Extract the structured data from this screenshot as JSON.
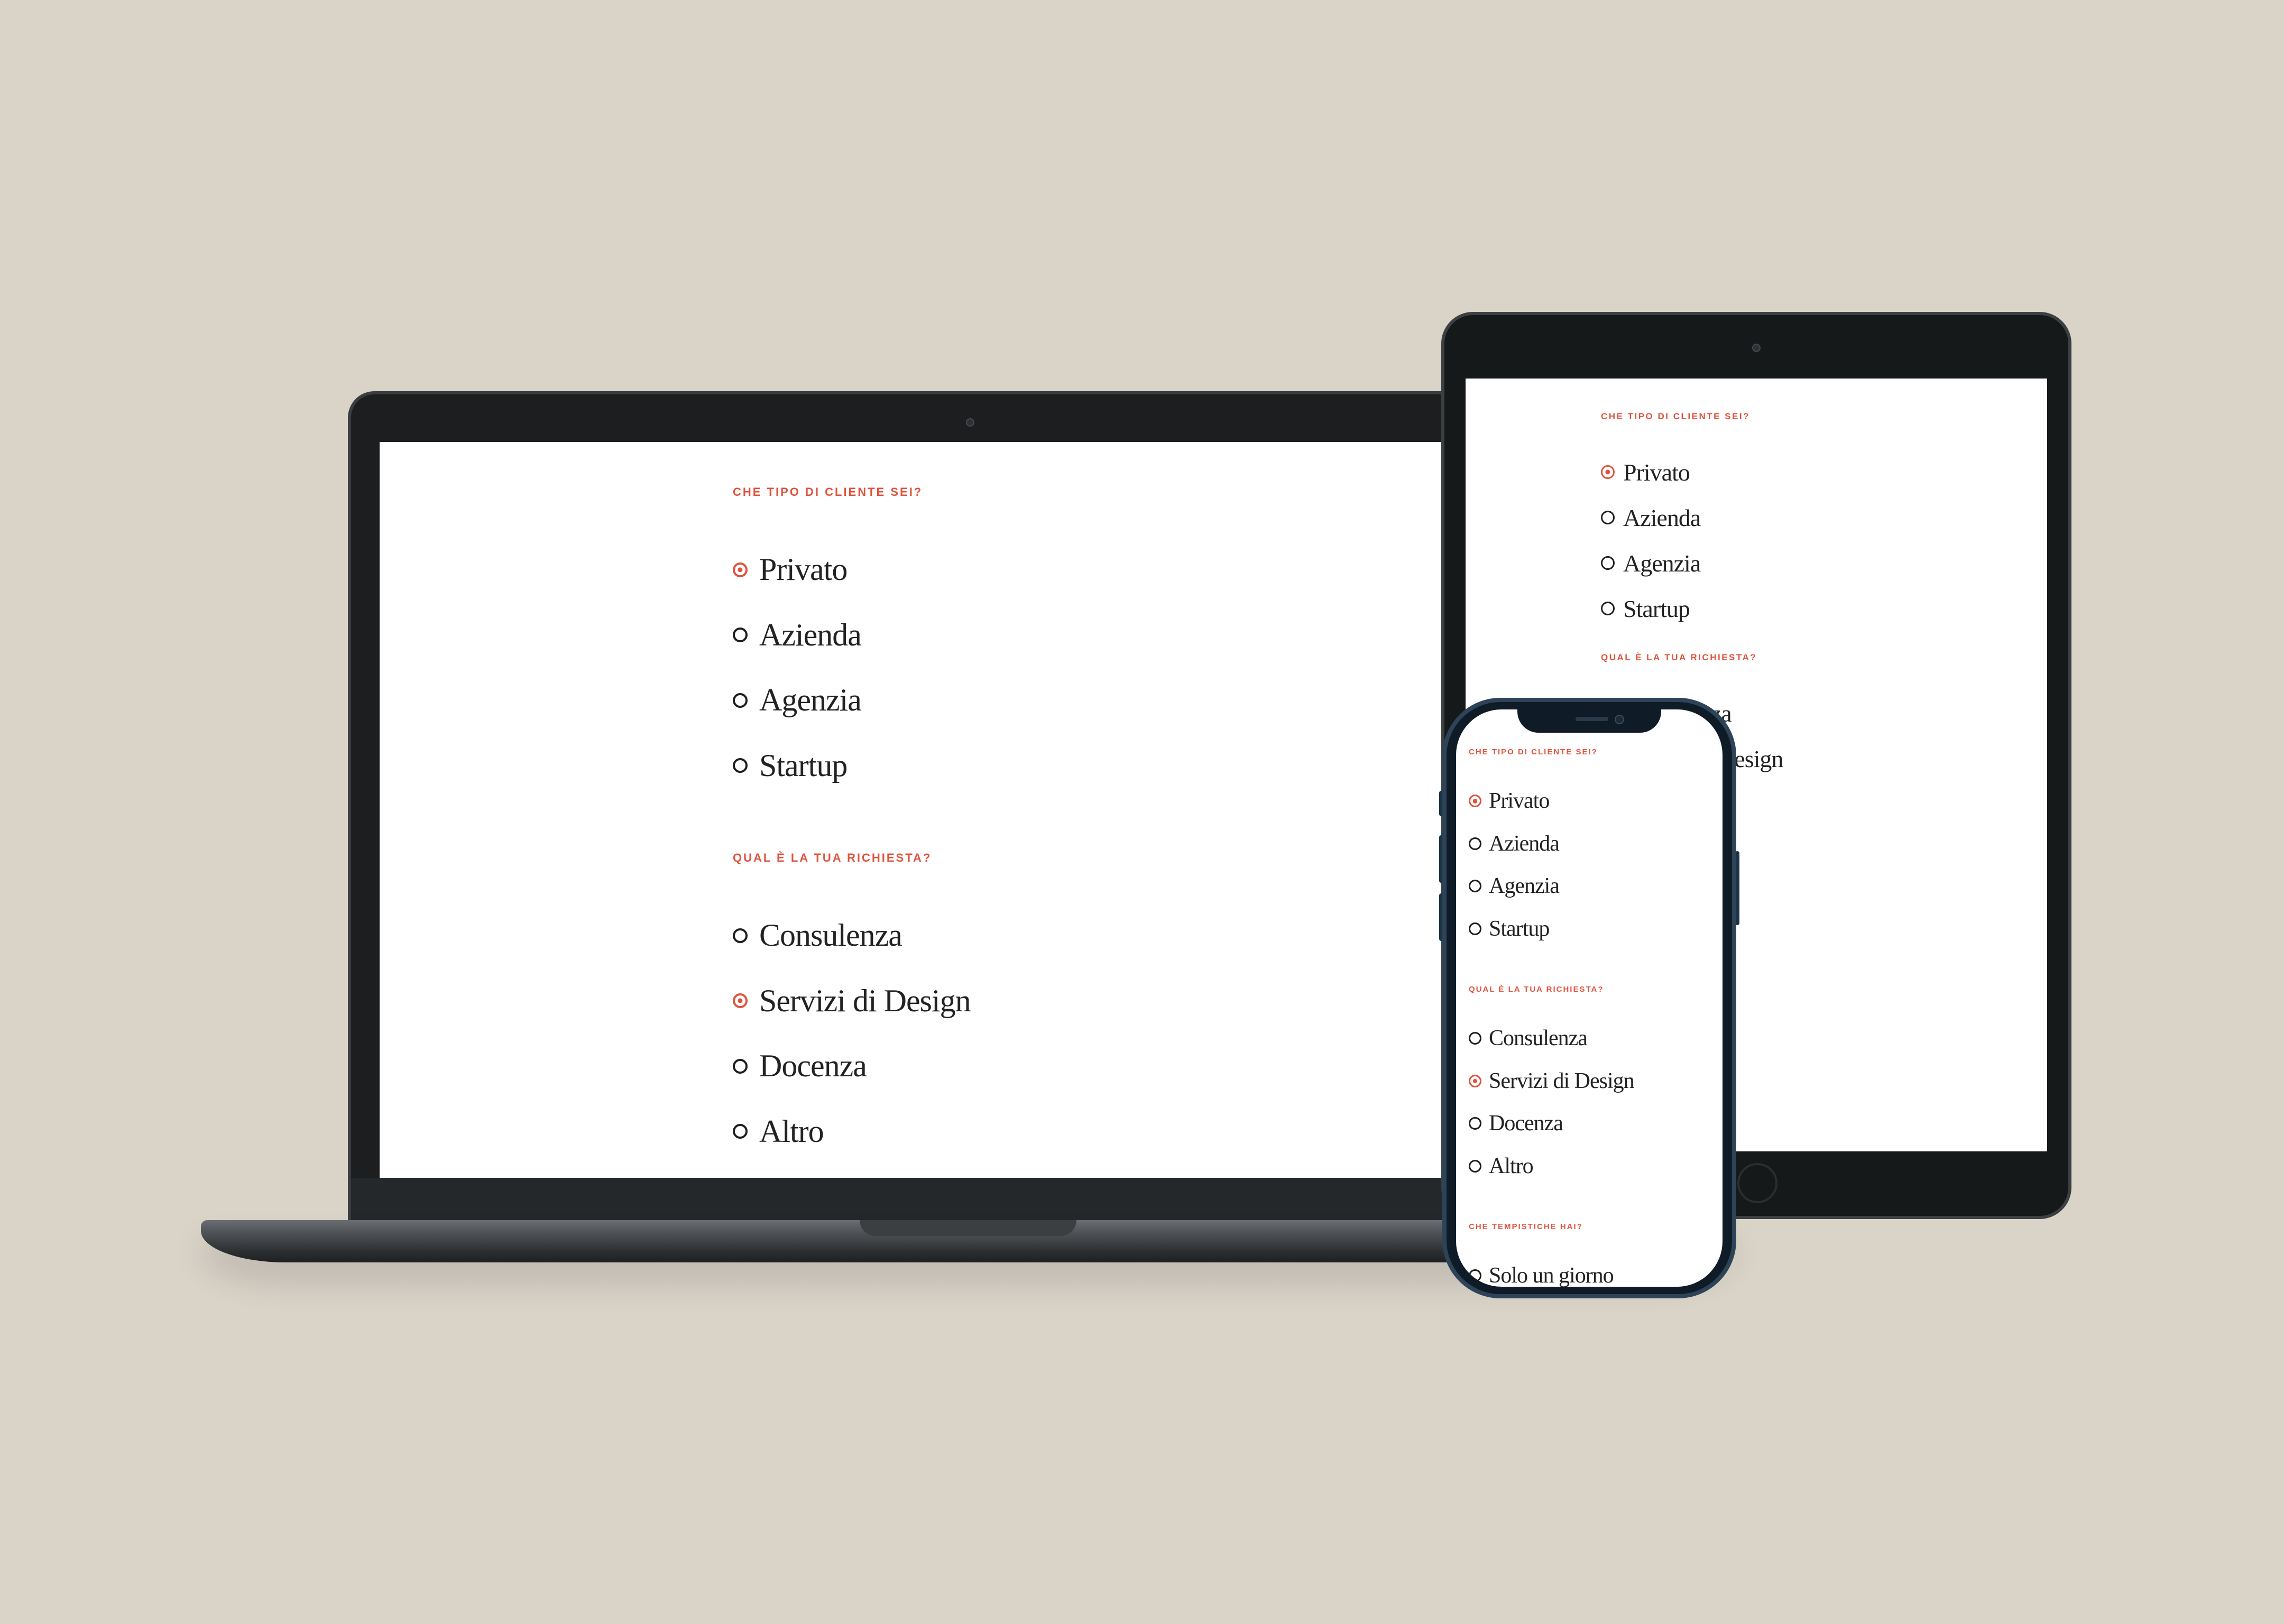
{
  "colors": {
    "background": "#dad3c8",
    "accent": "#e0533f",
    "text": "#222222",
    "device": "#1c1e1f"
  },
  "form": {
    "questions": [
      {
        "label": "CHE TIPO DI CLIENTE SEI?",
        "options": [
          {
            "label": "Privato",
            "selected": true
          },
          {
            "label": "Azienda",
            "selected": false
          },
          {
            "label": "Agenzia",
            "selected": false
          },
          {
            "label": "Startup",
            "selected": false
          }
        ]
      },
      {
        "label": "QUAL È LA TUA RICHIESTA?",
        "options": [
          {
            "label": "Consulenza",
            "selected": false
          },
          {
            "label": "Servizi di Design",
            "selected": true
          },
          {
            "label": "Docenza",
            "selected": false
          },
          {
            "label": "Altro",
            "selected": false
          }
        ]
      },
      {
        "label": "CHE TEMPISTICHE HAI?",
        "options": [
          {
            "label": "Solo un giorno",
            "selected": false
          }
        ]
      }
    ]
  }
}
